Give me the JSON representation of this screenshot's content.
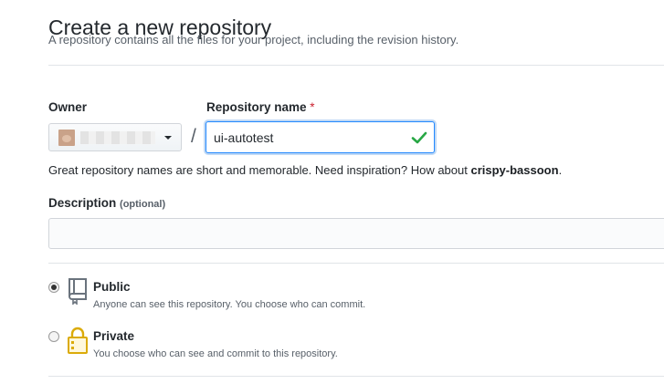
{
  "page": {
    "title": "Create a new repository",
    "subtitle": "A repository contains all the files for your project, including the revision history."
  },
  "owner": {
    "label": "Owner",
    "value": "",
    "avatar_color": "#c9a289"
  },
  "separator": "/",
  "repo_name": {
    "label": "Repository name",
    "required_marker": "*",
    "value": "ui-autotest",
    "valid_icon": "check-icon",
    "valid_color": "#28a745"
  },
  "hint": {
    "text": "Great repository names are short and memorable. Need inspiration? How about ",
    "suggestion": "crispy-bassoon",
    "suffix": "."
  },
  "description": {
    "label": "Description",
    "optional": "(optional)",
    "value": ""
  },
  "visibility": {
    "selected": "public",
    "options": [
      {
        "key": "public",
        "title": "Public",
        "description": "Anyone can see this repository. You choose who can commit.",
        "icon": "repo-icon"
      },
      {
        "key": "private",
        "title": "Private",
        "description": "You choose who can see and commit to this repository.",
        "icon": "lock-icon"
      }
    ]
  },
  "colors": {
    "accent": "#2188ff",
    "required": "#cb2431",
    "text": "#24292e",
    "muted": "#586069"
  }
}
